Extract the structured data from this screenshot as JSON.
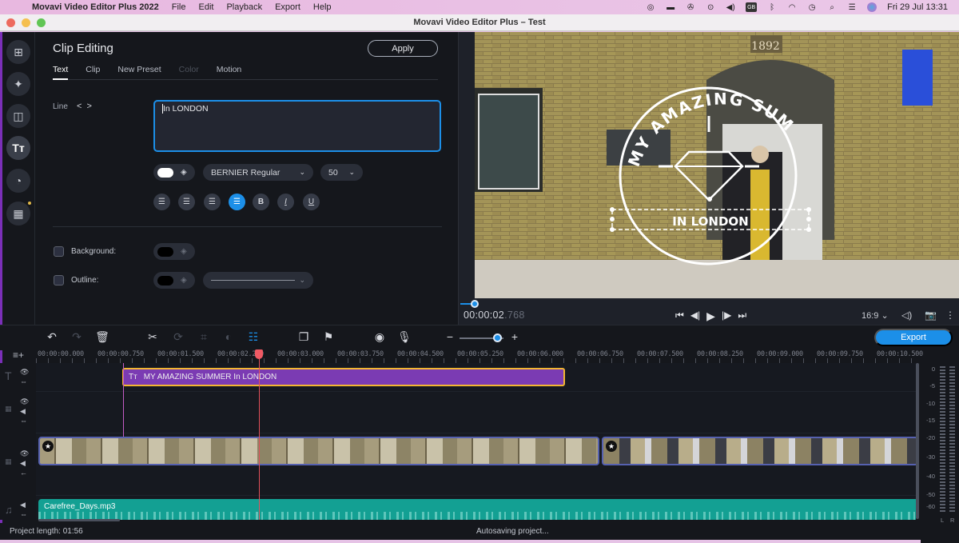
{
  "menubar": {
    "app_name": "Movavi Video Editor Plus 2022",
    "items": [
      "File",
      "Edit",
      "Playback",
      "Export",
      "Help"
    ],
    "status_icons": [
      "screen-record-icon",
      "display-icon",
      "aperture-icon",
      "play-circle-icon",
      "volume-icon",
      "keyboard-layout-icon",
      "bluetooth-icon",
      "wifi-icon",
      "time-machine-icon",
      "spotlight-search-icon",
      "control-center-icon",
      "siri-icon"
    ],
    "keyboard_layout": "GB",
    "datetime": "Fri 29 Jul  13:31"
  },
  "window": {
    "title": "Movavi Video Editor Plus – Test"
  },
  "sidebar": {
    "items": [
      {
        "name": "import",
        "icon": "add-media-icon"
      },
      {
        "name": "effects",
        "icon": "magic-wand-icon"
      },
      {
        "name": "transitions",
        "icon": "transition-icon"
      },
      {
        "name": "titles",
        "icon": "titles-icon",
        "active": true
      },
      {
        "name": "stickers",
        "icon": "sticker-icon"
      },
      {
        "name": "more-tools",
        "icon": "grid-icon",
        "has_notification": true
      }
    ]
  },
  "clip_editing": {
    "title": "Clip Editing",
    "apply_label": "Apply",
    "tabs": [
      {
        "label": "Text",
        "state": "active"
      },
      {
        "label": "Clip",
        "state": "normal"
      },
      {
        "label": "New Preset",
        "state": "normal"
      },
      {
        "label": "Color",
        "state": "disabled"
      },
      {
        "label": "Motion",
        "state": "normal"
      }
    ],
    "line_label": "Line",
    "line_prev": "<",
    "line_next": ">",
    "text_value": "In LONDON",
    "text_color": "#ffffff",
    "font": "BERNIER Regular",
    "font_size": "50",
    "format_buttons": [
      {
        "name": "align-left",
        "glyph": "≡",
        "active": false
      },
      {
        "name": "align-right",
        "glyph": "≡",
        "active": false
      },
      {
        "name": "align-justify",
        "glyph": "≡",
        "active": false
      },
      {
        "name": "align-center",
        "glyph": "≡",
        "active": true
      },
      {
        "name": "bold",
        "glyph": "B",
        "active": false
      },
      {
        "name": "italic",
        "glyph": "I",
        "active": false
      },
      {
        "name": "underline",
        "glyph": "U",
        "active": false
      }
    ],
    "background": {
      "label": "Background:",
      "checked": false,
      "color": "#000000"
    },
    "outline": {
      "label": "Outline:",
      "checked": false,
      "color": "#000000"
    }
  },
  "preview": {
    "overlay_top_text": "MY AMAZING SUMMER",
    "overlay_bottom_text": "IN LONDON",
    "sign_text": "1892",
    "timecode_main": "00:00:02",
    "timecode_ms": ".768",
    "aspect_ratio": "16:9 ⌄",
    "progress_fraction": 0.02
  },
  "toolbar": {
    "export_label": "Export",
    "zoom_level_fraction": 0.75
  },
  "timeline": {
    "ruler": [
      "00:00:00.000",
      "00:00:00.750",
      "00:00:01.500",
      "00:00:02.250",
      "00:00:03.000",
      "00:00:03.750",
      "00:00:04.500",
      "00:00:05.250",
      "00:00:06.000",
      "00:00:06.750",
      "00:00:07.500",
      "00:00:08.250",
      "00:00:09.000",
      "00:00:09.750",
      "00:00:10.500"
    ],
    "title_clip": "MY AMAZING SUMMER In LONDON",
    "audio_clip": "Carefree_Days.mp3",
    "meter_labels": [
      "0",
      "-5",
      "-10",
      "-15",
      "-20",
      "-30",
      "-40",
      "-50",
      "-60"
    ],
    "meter_channels": [
      "L",
      "R"
    ]
  },
  "status": {
    "project_length": "Project length: 01:56",
    "autosave": "Autosaving project..."
  }
}
